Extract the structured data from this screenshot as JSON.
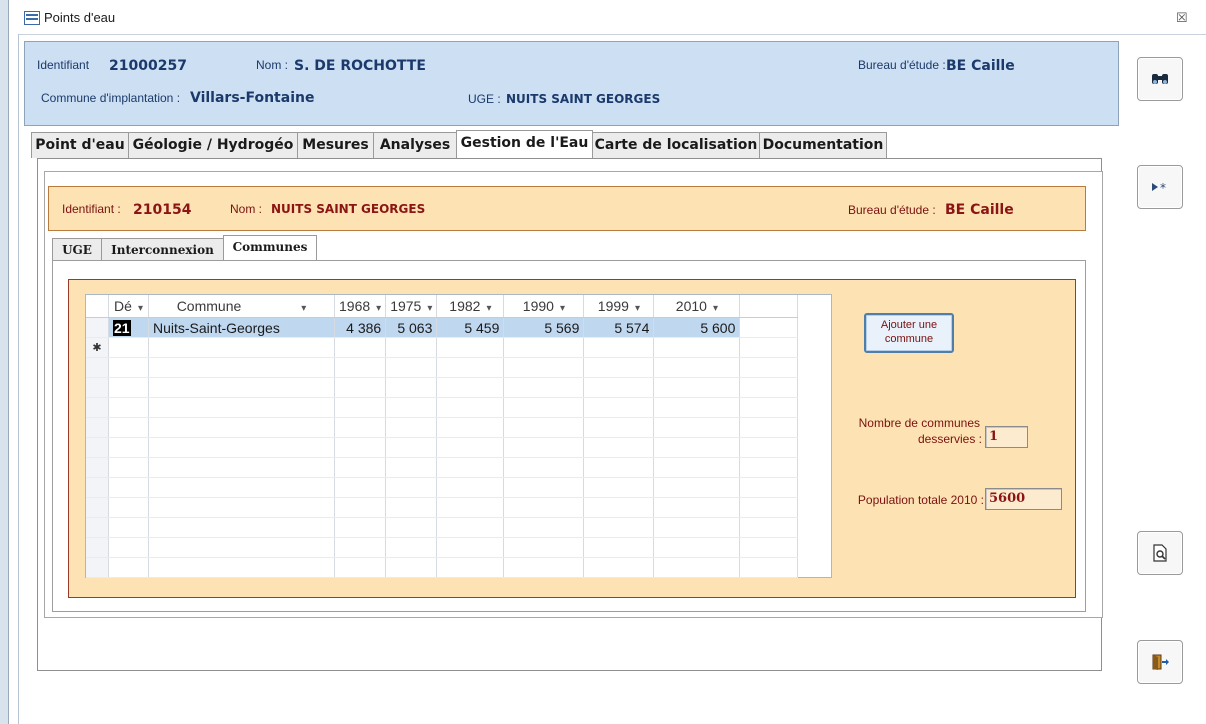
{
  "window": {
    "title": "Points d'eau",
    "close_glyph": "☒"
  },
  "header": {
    "identifiant_label": "Identifiant",
    "identifiant_value": "21000257",
    "nom_label": "Nom :",
    "nom_value": "S. DE ROCHOTTE",
    "bureau_label": "Bureau d'étude :",
    "bureau_value": "BE Caille",
    "commune_label": "Commune d'implantation :",
    "commune_value": "Villars-Fontaine",
    "uge_label": "UGE :",
    "uge_value": "NUITS SAINT GEORGES"
  },
  "tabs": [
    {
      "label": "Point d'eau"
    },
    {
      "label": "Géologie / Hydrogéo"
    },
    {
      "label": "Mesures"
    },
    {
      "label": "Analyses"
    },
    {
      "label": "Gestion de l'Eau",
      "active": true
    },
    {
      "label": "Carte de localisation"
    },
    {
      "label": "Documentation"
    }
  ],
  "uge_header": {
    "identifiant_label": "Identifiant :",
    "identifiant_value": "210154",
    "nom_label": "Nom :",
    "nom_value": "NUITS SAINT GEORGES",
    "bureau_label": "Bureau d'étude :",
    "bureau_value": "BE Caille"
  },
  "subtabs": [
    {
      "label": "UGE"
    },
    {
      "label": "Interconnexion"
    },
    {
      "label": "Communes",
      "active": true
    }
  ],
  "grid": {
    "columns": [
      "Dé",
      "Commune",
      "1968",
      "1975",
      "1982",
      "1990",
      "1999",
      "2010"
    ],
    "rows": [
      {
        "dep": "21",
        "commune": "Nuits-Saint-Georges",
        "v1968": "4 386",
        "v1975": "5 063",
        "v1982": "5 459",
        "v1990": "5 569",
        "v1999": "5 574",
        "v2010": "5 600"
      }
    ],
    "new_row_marker": "✱"
  },
  "buttons": {
    "add_commune_line1": "Ajouter une",
    "add_commune_line2": "commune"
  },
  "stats": {
    "nb_label_line1": "Nombre de communes",
    "nb_label_line2": "desservies :",
    "nb_value": "1",
    "pop_label": "Population totale 2010 :",
    "pop_value": "5600"
  },
  "side_buttons": {
    "find_icon": "binoculars-icon",
    "new_record_icon": "new-record-icon",
    "preview_icon": "print-preview-icon",
    "exit_icon": "exit-door-icon"
  }
}
